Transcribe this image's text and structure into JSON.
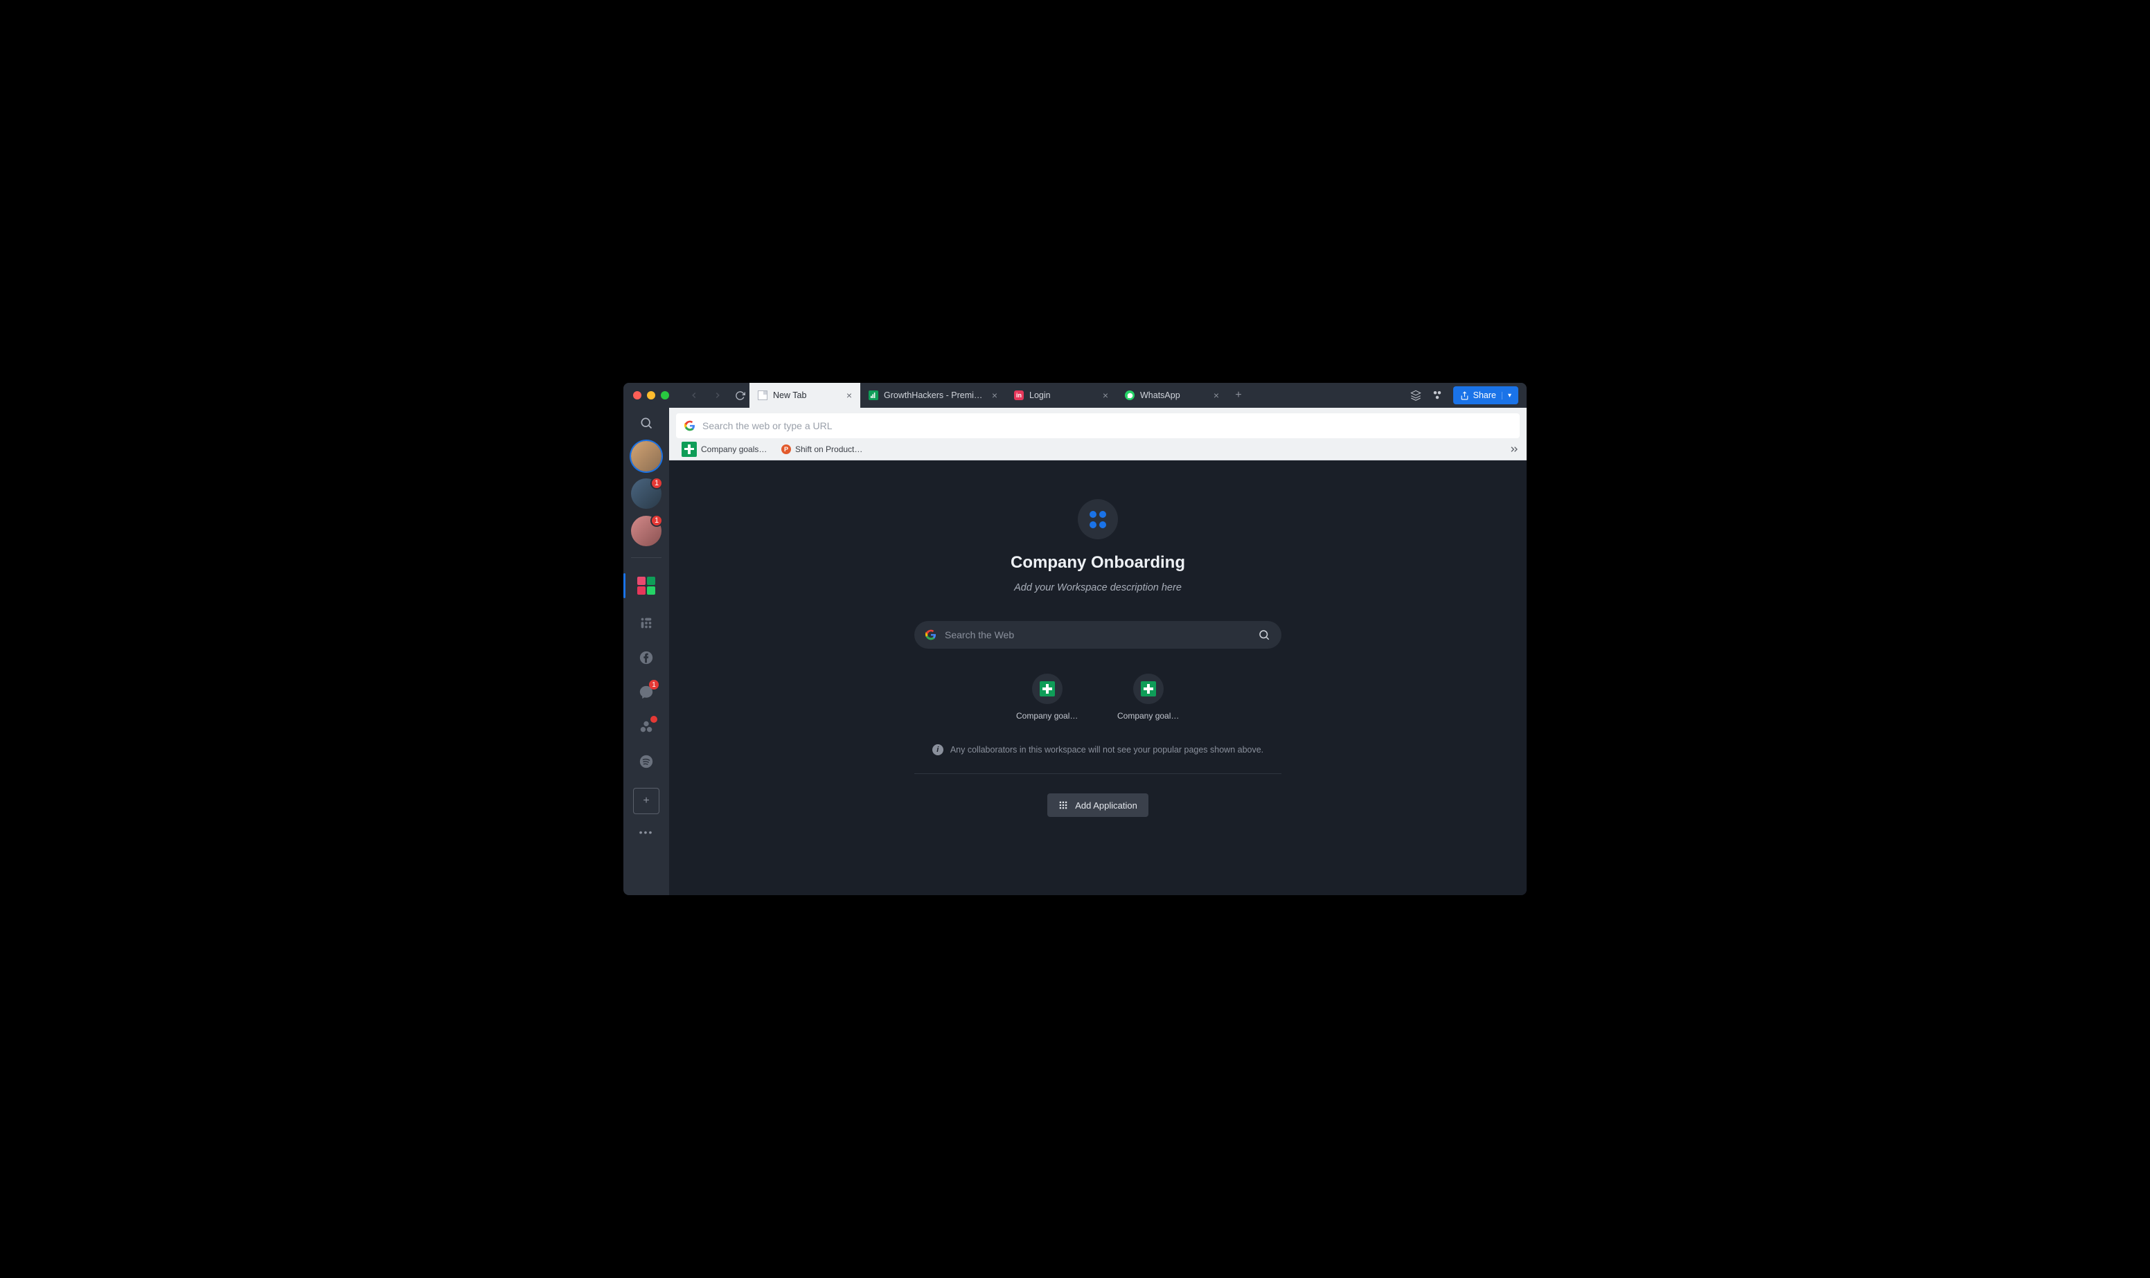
{
  "tabs": [
    {
      "title": "New Tab",
      "active": true,
      "icon": "document"
    },
    {
      "title": "GrowthHackers - Premier Gro…",
      "active": false,
      "icon": "growthhackers"
    },
    {
      "title": "Login",
      "active": false,
      "icon": "invision"
    },
    {
      "title": "WhatsApp",
      "active": false,
      "icon": "whatsapp"
    }
  ],
  "share_label": "Share",
  "url_placeholder": "Search the web or type a URL",
  "bookmarks": [
    {
      "label": "Company goals - …",
      "icon_color": "#0f9d58"
    },
    {
      "label": "Shift on ProductH…",
      "icon_color": "#e25a2c"
    }
  ],
  "sidebar": {
    "avatars": [
      {
        "badge": null,
        "active": true,
        "bg": "linear-gradient(135deg,#d4a574,#8a6d52)"
      },
      {
        "badge": "1",
        "active": false,
        "bg": "linear-gradient(135deg,#4a6580,#2a3a48)"
      },
      {
        "badge": "1",
        "active": false,
        "bg": "linear-gradient(135deg,#d48a8a,#8a5252)"
      }
    ],
    "workspace_minis": [
      "#e84a6f",
      "#0f9d58",
      "#e6375a",
      "#25d366"
    ],
    "apps": [
      {
        "name": "slack",
        "badge": null
      },
      {
        "name": "facebook",
        "badge": null
      },
      {
        "name": "messenger",
        "badge": "1"
      },
      {
        "name": "asana",
        "badge": ""
      },
      {
        "name": "spotify",
        "badge": null
      }
    ]
  },
  "page": {
    "title": "Company Onboarding",
    "subtitle": "Add your Workspace description here",
    "search_placeholder": "Search the Web",
    "shortcuts": [
      {
        "label": "Company goals…"
      },
      {
        "label": "Company goals…"
      }
    ],
    "info_text": "Any collaborators in this workspace will not see your popular pages shown above.",
    "add_app_label": "Add Application"
  }
}
